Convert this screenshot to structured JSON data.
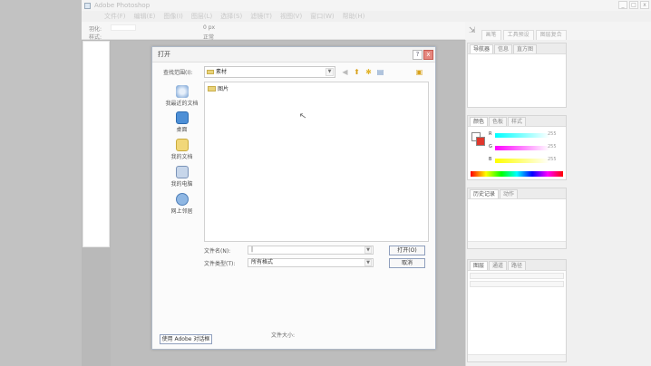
{
  "app": {
    "title": "Adobe Photoshop",
    "menu": [
      "文件(F)",
      "编辑(E)",
      "图像(I)",
      "图层(L)",
      "选择(S)",
      "滤镜(T)",
      "视图(V)",
      "窗口(W)",
      "帮助(H)"
    ],
    "window_buttons": [
      "_",
      "□",
      "x"
    ]
  },
  "options_bar": {
    "label1": "羽化:",
    "label2": "样式:",
    "value1": "0 px",
    "value2": "正常"
  },
  "brush_bar": {
    "tabs": [
      "画笔",
      "工具预设",
      "图层复合"
    ]
  },
  "palettes": {
    "navigator": {
      "tabs": [
        "导航器",
        "信息",
        "直方图"
      ]
    },
    "color": {
      "tabs": [
        "颜色",
        "色板",
        "样式"
      ],
      "channels": [
        {
          "label": "R",
          "value": "255"
        },
        {
          "label": "G",
          "value": "255"
        },
        {
          "label": "B",
          "value": "255"
        }
      ]
    },
    "history": {
      "tabs": [
        "历史记录",
        "动作"
      ]
    },
    "layers": {
      "tabs": [
        "图层",
        "通道",
        "路径"
      ]
    }
  },
  "dialog": {
    "title": "打开",
    "help_button": "?",
    "close_button": "x",
    "look_in_label": "查找范围(I):",
    "look_in_value": "素材",
    "places": [
      {
        "label": "我最近的文档",
        "icon": "recent-docs-icon"
      },
      {
        "label": "桌面",
        "icon": "desktop-icon"
      },
      {
        "label": "我的文档",
        "icon": "my-documents-icon"
      },
      {
        "label": "我的电脑",
        "icon": "my-computer-icon"
      },
      {
        "label": "网上邻居",
        "icon": "network-icon"
      }
    ],
    "files": [
      {
        "name": "图片",
        "type": "folder"
      }
    ],
    "filename_label": "文件名(N):",
    "filename_value": "|",
    "filetype_label": "文件类型(T):",
    "filetype_value": "所有格式",
    "open_button": "打开(O)",
    "cancel_button": "取消",
    "adobe_dialog_button": "使用 Adobe 对话框",
    "filesize_label": "文件大小:"
  }
}
